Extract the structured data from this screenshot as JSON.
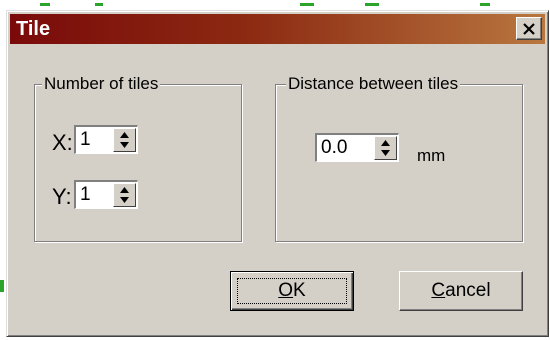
{
  "dialog": {
    "title": "Tile",
    "close_icon": "close-icon"
  },
  "tiles_group": {
    "legend": "Number of tiles",
    "x_label": "X:",
    "x_value": "1",
    "y_label": "Y:",
    "y_value": "1"
  },
  "distance_group": {
    "legend": "Distance between tiles",
    "value": "0.0",
    "unit": "mm"
  },
  "buttons": {
    "ok_mnemonic": "O",
    "ok_rest": "K",
    "cancel_mnemonic": "C",
    "cancel_rest": "ancel"
  },
  "colors": {
    "titlebar_start": "#7a0a0a",
    "titlebar_end": "#b9773f",
    "face": "#d4d0c8"
  }
}
